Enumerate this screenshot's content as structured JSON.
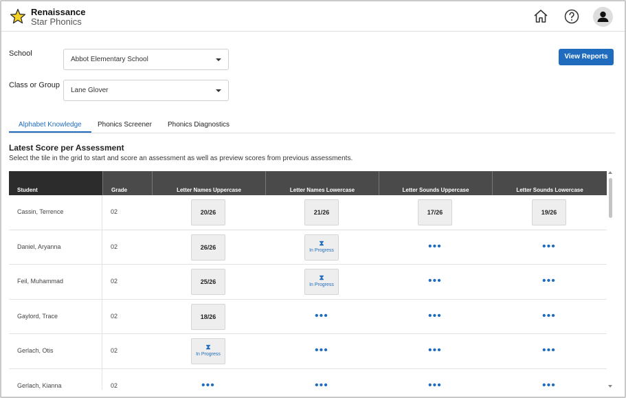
{
  "brand": {
    "line1": "Renaissance",
    "line2": "Star Phonics"
  },
  "header_icons": [
    "home-icon",
    "help-icon",
    "user-icon"
  ],
  "filters": {
    "school_label": "School",
    "school_value": "Abbot Elementary School",
    "class_label": "Class or Group",
    "class_value": "Lane Glover"
  },
  "view_reports_label": "View Reports",
  "tabs": [
    {
      "label": "Alphabet Knowledge",
      "active": true
    },
    {
      "label": "Phonics Screener",
      "active": false
    },
    {
      "label": "Phonics Diagnostics",
      "active": false
    }
  ],
  "section": {
    "title": "Latest Score per Assessment",
    "description": "Select the tile in the grid to start and score an assessment as well as preview scores from previous assessments."
  },
  "table": {
    "headers": [
      "Student",
      "Grade",
      "Letter Names Uppercase",
      "Letter Names Lowercase",
      "Letter Sounds Uppercase",
      "Letter Sounds Lowercase"
    ],
    "in_progress_label": "In Progress",
    "rows": [
      {
        "student": "Cassin, Terrence",
        "grade": "02",
        "scores": [
          "20/26",
          "21/26",
          "17/26",
          "19/26"
        ]
      },
      {
        "student": "Daniel, Aryanna",
        "grade": "02",
        "scores": [
          "26/26",
          "In Progress",
          "",
          ""
        ]
      },
      {
        "student": "Feil, Muhammad",
        "grade": "02",
        "scores": [
          "25/26",
          "In Progress",
          "",
          ""
        ]
      },
      {
        "student": "Gaylord, Trace",
        "grade": "02",
        "scores": [
          "18/26",
          "",
          "",
          ""
        ]
      },
      {
        "student": "Gerlach, Otis",
        "grade": "02",
        "scores": [
          "In Progress",
          "",
          "",
          ""
        ]
      },
      {
        "student": "Gerlach, Kianna",
        "grade": "02",
        "scores": [
          "",
          "",
          "",
          ""
        ]
      }
    ]
  },
  "colors": {
    "accent": "#1f6cbf",
    "star": "#f5d22a",
    "header_dark": "#2c2c2c",
    "header_mid": "#4a4a4a"
  }
}
